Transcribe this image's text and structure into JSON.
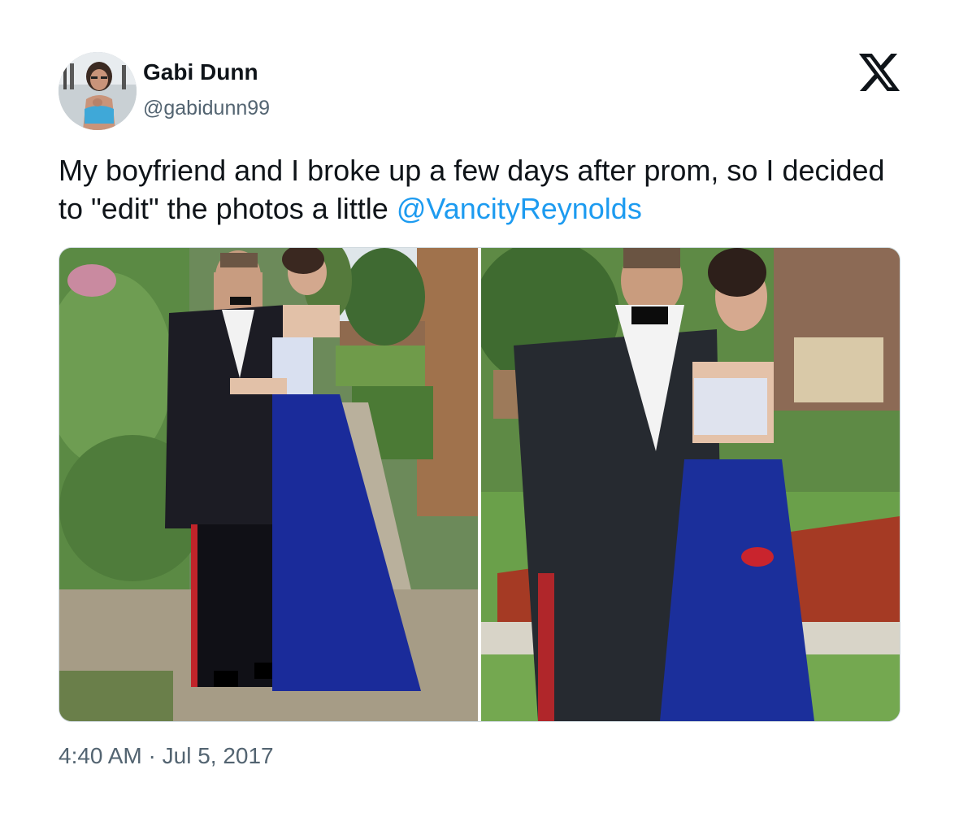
{
  "author": {
    "name": "Gabi Dunn",
    "handle": "@gabidunn99"
  },
  "platform_logo_icon": "x-logo-icon",
  "tweet": {
    "text_before_mention": "My boyfriend and I broke up a few days after prom, so I decided to \"edit\" the photos a little ",
    "mention": "@VancityReynolds"
  },
  "media_icons": [
    "photo-left",
    "photo-right"
  ],
  "meta": {
    "time": "4:40 AM",
    "separator": " · ",
    "date": "Jul 5, 2017"
  },
  "colors": {
    "text": "#0f1419",
    "secondary": "#536471",
    "link": "#1d9bf0",
    "border": "#cfd9de"
  }
}
